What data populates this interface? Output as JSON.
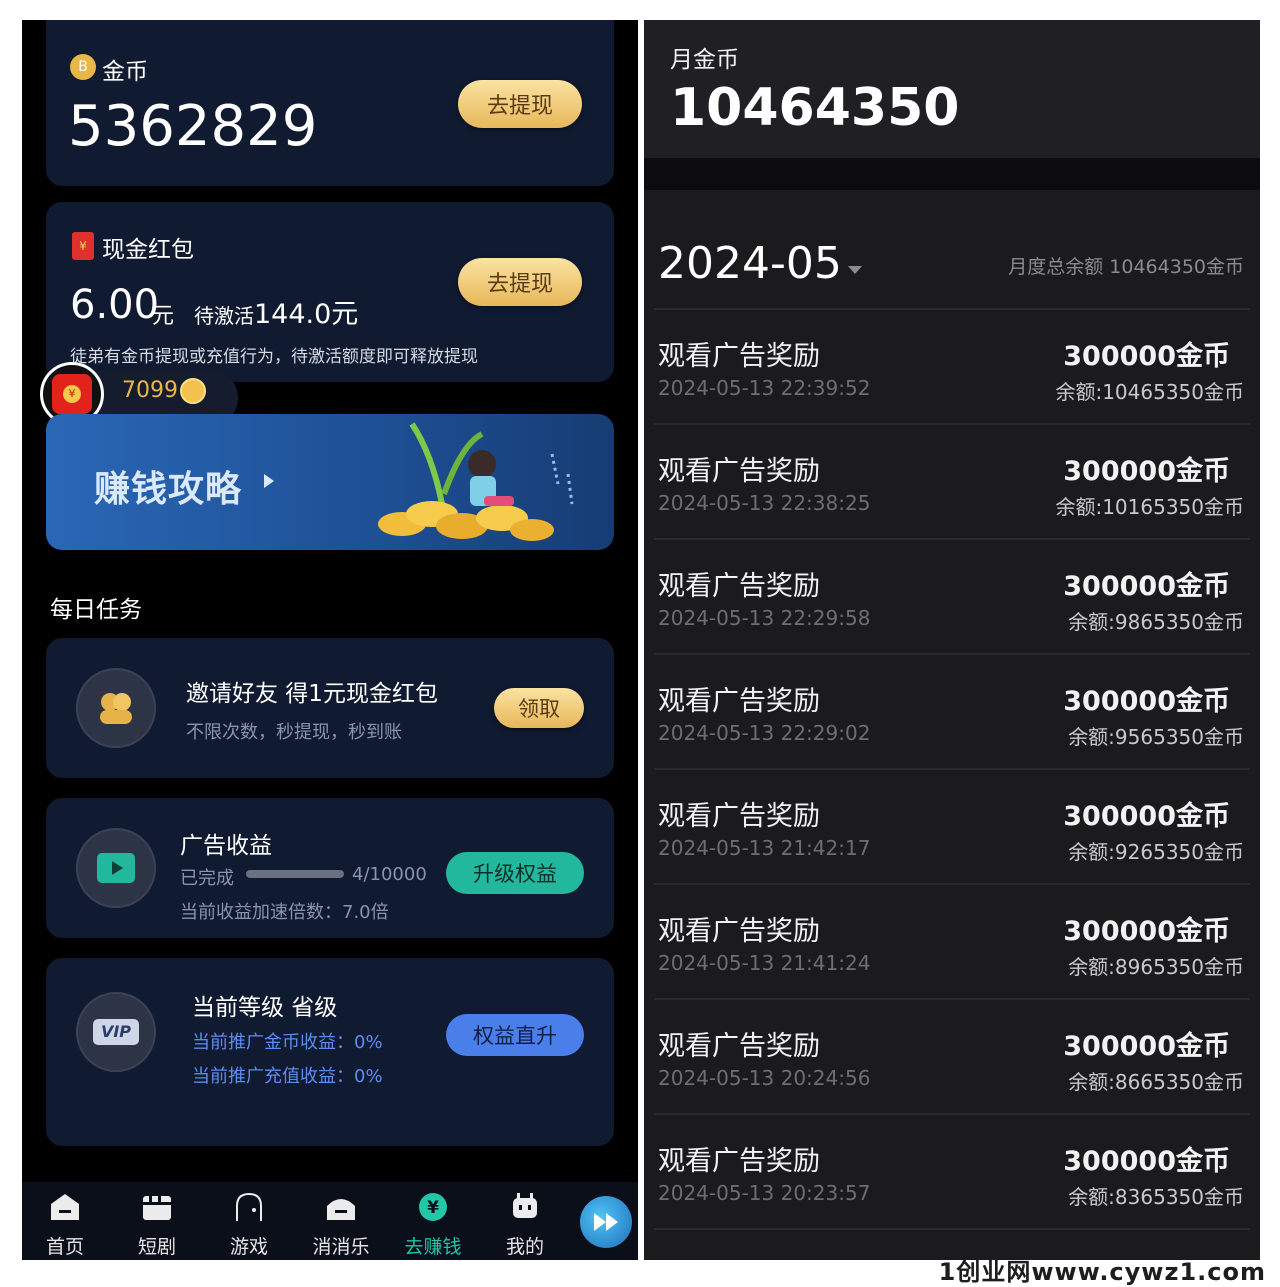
{
  "left": {
    "coins": {
      "label": "金币",
      "value": "5362829",
      "button": "去提现"
    },
    "cash": {
      "label": "现金红包",
      "amount": "6.00",
      "unit": "元",
      "pending_label": "待激活",
      "pending_value": "144.0元",
      "note": "徒弟有金币提现或充值行为，待激活额度即可释放提现",
      "button": "去提现"
    },
    "floating_coins": "7099",
    "banner": {
      "title": "赚钱攻略"
    },
    "section_title": "每日任务",
    "tasks": {
      "invite": {
        "title": "邀请好友 得1元现金红包",
        "subtitle": "不限次数，秒提现，秒到账",
        "button": "领取"
      },
      "ads": {
        "title": "广告收益",
        "progress_label": "已完成",
        "progress_text": "4/10000",
        "progress_value": 0.0004,
        "multiplier": "当前收益加速倍数：7.0倍",
        "button": "升级权益"
      },
      "level": {
        "title": "当前等级 省级",
        "line1": "当前推广金币收益：0%",
        "line2": "当前推广充值收益：0%",
        "button": "权益直升",
        "badge": "VIP"
      }
    },
    "nav": [
      "首页",
      "短剧",
      "游戏",
      "消消乐",
      "去赚钱",
      "我的"
    ],
    "nav_active_index": 4
  },
  "right": {
    "month_label": "月金币",
    "month_total": "10464350",
    "month": "2024-05",
    "month_summary": "月度总余额 10464350金币",
    "records": [
      {
        "title": "观看广告奖励",
        "time": "2024-05-13 22:39:52",
        "amount": "300000金币",
        "balance": "余额:10465350金币"
      },
      {
        "title": "观看广告奖励",
        "time": "2024-05-13 22:38:25",
        "amount": "300000金币",
        "balance": "余额:10165350金币"
      },
      {
        "title": "观看广告奖励",
        "time": "2024-05-13 22:29:58",
        "amount": "300000金币",
        "balance": "余额:9865350金币"
      },
      {
        "title": "观看广告奖励",
        "time": "2024-05-13 22:29:02",
        "amount": "300000金币",
        "balance": "余额:9565350金币"
      },
      {
        "title": "观看广告奖励",
        "time": "2024-05-13 21:42:17",
        "amount": "300000金币",
        "balance": "余额:9265350金币"
      },
      {
        "title": "观看广告奖励",
        "time": "2024-05-13 21:41:24",
        "amount": "300000金币",
        "balance": "余额:8965350金币"
      },
      {
        "title": "观看广告奖励",
        "time": "2024-05-13 20:24:56",
        "amount": "300000金币",
        "balance": "余额:8665350金币"
      },
      {
        "title": "观看广告奖励",
        "time": "2024-05-13 20:23:57",
        "amount": "300000金币",
        "balance": "余额:8365350金币"
      }
    ]
  },
  "watermark": "1创业网www.cywz1.com"
}
